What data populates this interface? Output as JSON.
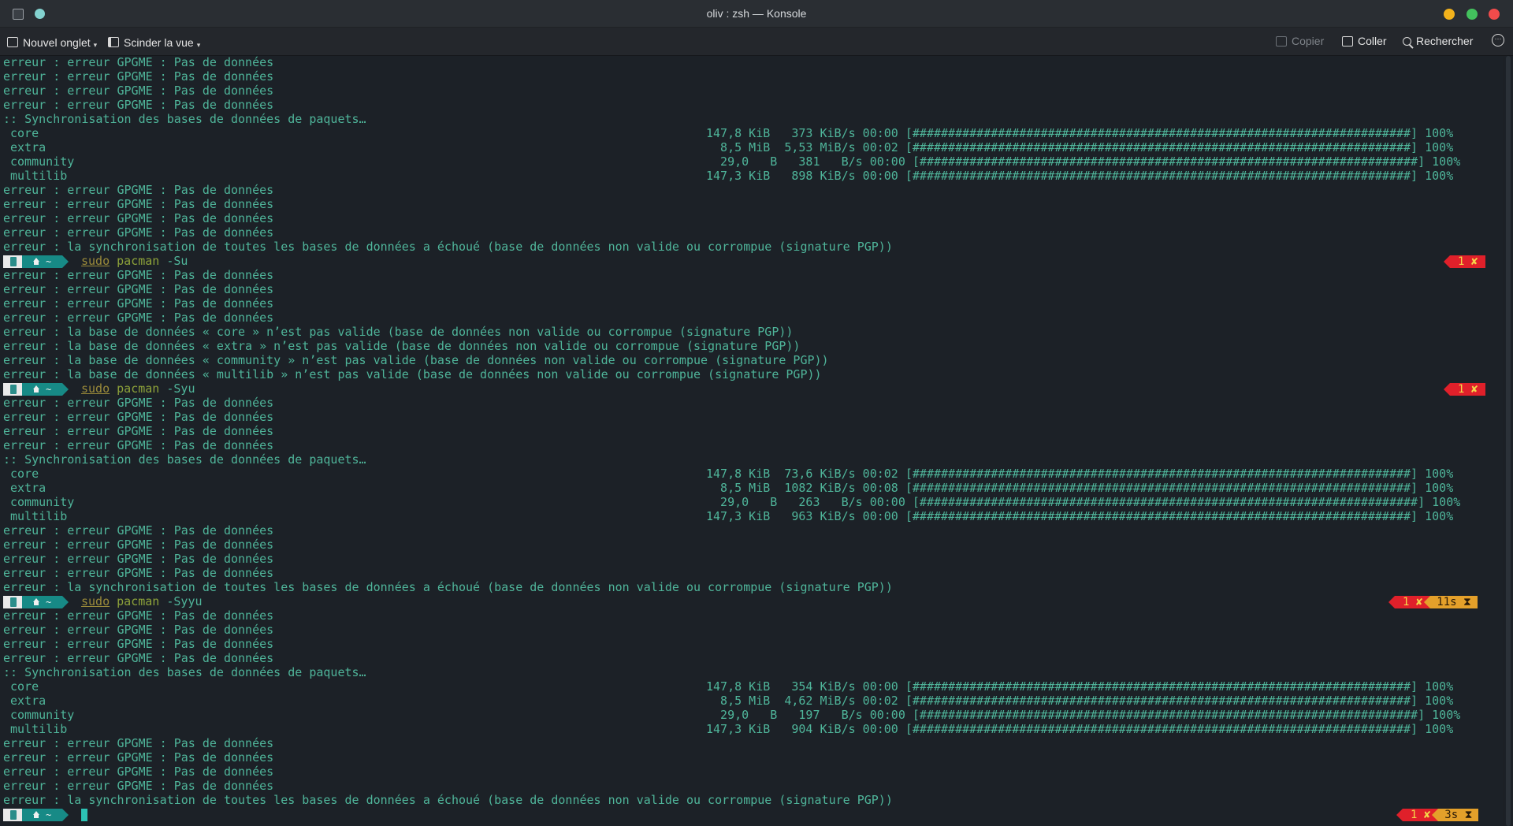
{
  "window": {
    "title": "oliv : zsh — Konsole"
  },
  "toolbar": {
    "new_tab": "Nouvel onglet",
    "split_view": "Scinder la vue",
    "copy": "Copier",
    "paste": "Coller",
    "search": "Rechercher"
  },
  "terminal": {
    "gpgme_error": "erreur : erreur GPGME : Pas de données",
    "sync_header": ":: Synchronisation des bases de données de paquets…",
    "sync_failed": "erreur : la synchronisation de toutes les bases de données a échoué (base de données non valide ou corrompue (signature PGP))",
    "db_invalid": [
      "erreur : la base de données « core » n’est pas valide (base de données non valide ou corrompue (signature PGP))",
      "erreur : la base de données « extra » n’est pas valide (base de données non valide ou corrompue (signature PGP))",
      "erreur : la base de données « community » n’est pas valide (base de données non valide ou corrompue (signature PGP))",
      "erreur : la base de données « multilib » n’est pas valide (base de données non valide ou corrompue (signature PGP))"
    ],
    "sync_blocks": [
      [
        {
          "name": "core",
          "stats": "147,8 KiB   373 KiB/s 00:00 [######################################################################] 100%"
        },
        {
          "name": "extra",
          "stats": "  8,5 MiB  5,53 MiB/s 00:02 [######################################################################] 100%"
        },
        {
          "name": "community",
          "stats": "  29,0   B   381   B/s 00:00 [######################################################################] 100%"
        },
        {
          "name": "multilib",
          "stats": "147,3 KiB   898 KiB/s 00:00 [######################################################################] 100%"
        }
      ],
      [
        {
          "name": "core",
          "stats": "147,8 KiB  73,6 KiB/s 00:02 [######################################################################] 100%"
        },
        {
          "name": "extra",
          "stats": "  8,5 MiB  1082 KiB/s 00:08 [######################################################################] 100%"
        },
        {
          "name": "community",
          "stats": "  29,0   B   263   B/s 00:00 [######################################################################] 100%"
        },
        {
          "name": "multilib",
          "stats": "147,3 KiB   963 KiB/s 00:00 [######################################################################] 100%"
        }
      ],
      [
        {
          "name": "core",
          "stats": "147,8 KiB   354 KiB/s 00:00 [######################################################################] 100%"
        },
        {
          "name": "extra",
          "stats": "  8,5 MiB  4,62 MiB/s 00:02 [######################################################################] 100%"
        },
        {
          "name": "community",
          "stats": "  29,0   B   197   B/s 00:00 [######################################################################] 100%"
        },
        {
          "name": "multilib",
          "stats": "147,3 KiB   904 KiB/s 00:00 [######################################################################] 100%"
        }
      ]
    ],
    "commands": [
      {
        "sudo": "sudo",
        "prog": "pacman",
        "args": "-Su",
        "status_err": "1 ✘",
        "status_time": ""
      },
      {
        "sudo": "sudo",
        "prog": "pacman",
        "args": "-Syu",
        "status_err": "1 ✘",
        "status_time": ""
      },
      {
        "sudo": "sudo",
        "prog": "pacman",
        "args": "-Syyu",
        "status_err": "1 ✘",
        "status_time": "11s ⧗"
      }
    ],
    "final_prompt": {
      "status_err": "1 ✘",
      "status_time": "3s ⧗"
    },
    "prompt_dir": "~"
  },
  "colors": {
    "terminal_text": "#4fb59a",
    "prompt_segment": "#178a86",
    "error_badge": "#e0202a",
    "time_badge": "#e4a02a"
  }
}
